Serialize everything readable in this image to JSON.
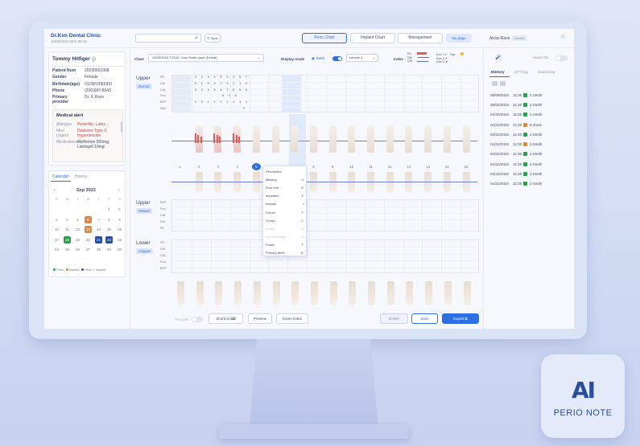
{
  "header": {
    "clinic": "Dr.Kim Dental Clinic",
    "datetime": "10/05/2023 Mon 09:33",
    "sync_label": "Sync",
    "tabs": [
      "Perio Chart",
      "Implant Chart",
      "Management"
    ],
    "my_page": "My page",
    "user": "Alcac-Ross",
    "user_badge": "Dentist"
  },
  "patient": {
    "name": "Tommy Hilfiger",
    "fields": [
      {
        "k": "Patient Num",
        "v": "20230501008"
      },
      {
        "k": "Gender",
        "v": "Female"
      },
      {
        "k": "Birthdate(age)",
        "v": "01/28/1990(43)"
      },
      {
        "k": "Phone",
        "v": "(206)987-8543"
      },
      {
        "k": "Primary provider",
        "v": "Dr. K.Ross"
      }
    ],
    "alert_title": "Medical alert",
    "alerts": [
      {
        "k": "Allergies",
        "v": "Penicillin, Latex"
      },
      {
        "k": "Med Urgent",
        "v": "Diabetes Type II, Hypertension"
      },
      {
        "k": "Medications",
        "v": "Metformin 500mg, Lisinopril 10mg"
      }
    ]
  },
  "calendar": {
    "tabs": [
      "Calendar",
      "History"
    ],
    "month": "Sep 2023",
    "days": [
      "S",
      "M",
      "T",
      "W",
      "T",
      "F",
      "S"
    ],
    "cells": [
      "",
      "",
      "",
      "",
      "",
      "1",
      "2",
      "3",
      "4",
      "5",
      "6",
      "7",
      "8",
      "9",
      "10",
      "11",
      "12",
      "13",
      "14",
      "15",
      "16",
      "17",
      "18",
      "19",
      "20",
      "21",
      "22",
      "23",
      "24",
      "25",
      "26",
      "27",
      "28",
      "29",
      "30"
    ],
    "legend": [
      "Perio",
      "Implant",
      "Perio + Implant"
    ]
  },
  "chart_toolbar": {
    "chart_label": "Chart",
    "chart_value": "10/05/2023 TODAY John Smith [open Dental]",
    "display_label": "Display mode",
    "teeth_label": "Teeth",
    "sample_value": "sample-1",
    "index_label": "Index",
    "index_items": [
      "PD",
      "GM",
      "CAL"
    ],
    "furc_items": [
      "Furc 1",
      "Furc 2",
      "Furc 3"
    ],
    "sup_label": "Sup"
  },
  "sections": {
    "upper": "Upper",
    "buccal": "Buccal",
    "palatal": "Palatal",
    "lower": "Lower",
    "lingual": "Lingual",
    "row_labels_top": [
      "PD",
      "GM",
      "CAL",
      "Furc",
      "BOP",
      "Mob"
    ],
    "row_labels_mid": [
      "BOP",
      "Furc",
      "CAL",
      "GM",
      "PD"
    ],
    "row_labels_low": [
      "PD",
      "GM",
      "CAL",
      "Furc",
      "BOP"
    ],
    "pd_values": [
      "3",
      "2",
      "3",
      "4",
      "5",
      "3",
      "4",
      "6",
      "7"
    ],
    "gm_values": [
      "0",
      "1",
      "0",
      "3",
      "2",
      "3",
      "2",
      "1",
      "0"
    ],
    "cal_values": [
      "3",
      "2",
      "3",
      "6",
      "6",
      "7",
      "6",
      "6",
      "0"
    ],
    "furc_values": [
      "0",
      "2",
      "0"
    ],
    "bop_values": [
      "1",
      "0",
      "1",
      "1",
      "1",
      "1",
      "1",
      "1",
      "1"
    ],
    "mob_value": "2"
  },
  "tooth_numbers": [
    "1",
    "2",
    "3",
    "4",
    "5",
    "6",
    "7",
    "8",
    "9",
    "10",
    "11",
    "12",
    "13",
    "14",
    "15",
    "16"
  ],
  "context_menu": [
    {
      "label": "Permanent",
      "key": ""
    },
    {
      "label": "Missing",
      "key": "X"
    },
    {
      "label": "Root rest",
      "key": "O"
    },
    {
      "label": "Impacted",
      "key": "Z"
    },
    {
      "label": "Implant",
      "key": "I"
    },
    {
      "label": "Fixture",
      "key": "F"
    },
    {
      "label": "Crown",
      "key": "C"
    },
    {
      "label": "Bridge",
      "key": "B"
    },
    {
      "label": "Normal bridge",
      "key": "N"
    },
    {
      "label": "Pontic",
      "key": "T"
    },
    {
      "label": "Primary teeth",
      "key": "D"
    }
  ],
  "footer": {
    "key_pad": "Key pad",
    "shortcut": "Shortcut",
    "preview": "Preview",
    "exam_notes": "Exam notes",
    "delete": "Delete",
    "save": "Save",
    "export": "Export"
  },
  "right_panel": {
    "voice": "Voice On",
    "tabs": [
      "History",
      "STT log",
      "Saved log"
    ],
    "rows": [
      {
        "date": "05/09/2023",
        "time": "11:30",
        "doc": "J.Smith",
        "c": "#2e9d4f"
      },
      {
        "date": "05/02/2023",
        "time": "11:30",
        "doc": "J.Smith",
        "c": "#2e9d4f"
      },
      {
        "date": "04/30/2023",
        "time": "11:30",
        "doc": "J.Smith",
        "c": "#2e9d4f"
      },
      {
        "date": "04/22/2023",
        "time": "11:30",
        "doc": "K.Ross",
        "c": "#e0883c"
      },
      {
        "date": "04/22/2023",
        "time": "11:30",
        "doc": "J.Smith",
        "c": "#2e9d4f"
      },
      {
        "date": "04/22/2023",
        "time": "11:30",
        "doc": "J.Smith",
        "c": "#e0883c"
      },
      {
        "date": "04/22/2023",
        "time": "11:30",
        "doc": "J.Smith",
        "c": "#2e9d4f"
      },
      {
        "date": "04/22/2023",
        "time": "11:30",
        "doc": "J.Smith",
        "c": "#2e9d4f"
      },
      {
        "date": "04/22/2023",
        "time": "11:30",
        "doc": "J.Smith",
        "c": "#2e9d4f"
      },
      {
        "date": "04/22/2023",
        "time": "11:30",
        "doc": "J.Smith",
        "c": "#2e9d4f"
      }
    ]
  },
  "brand": {
    "mark": "AI",
    "name": "PERIO NOTE"
  }
}
